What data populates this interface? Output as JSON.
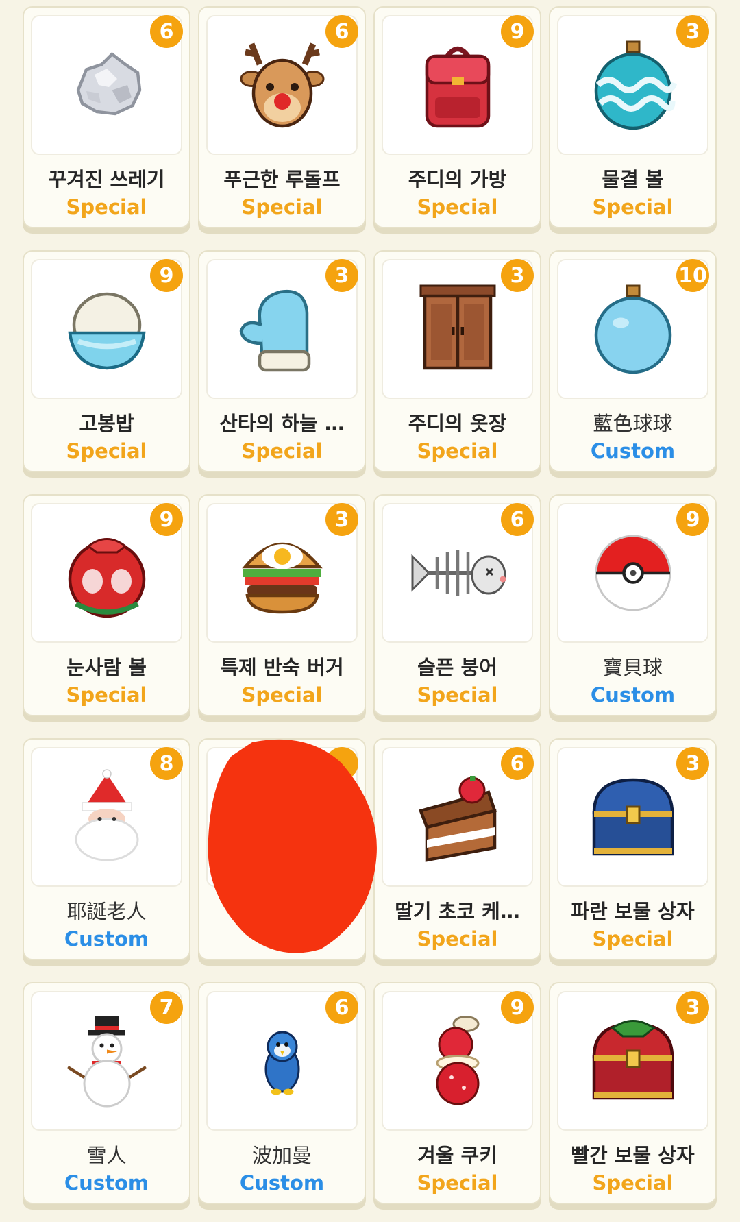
{
  "cards": [
    {
      "name": "꾸겨진 쓰레기",
      "tag": "Special",
      "count": "6",
      "icon": "crumpled-paper-icon"
    },
    {
      "name": "푸근한 루돌프",
      "tag": "Special",
      "count": "6",
      "icon": "reindeer-icon"
    },
    {
      "name": "주디의 가방",
      "tag": "Special",
      "count": "9",
      "icon": "red-backpack-icon"
    },
    {
      "name": "물결 볼",
      "tag": "Special",
      "count": "3",
      "icon": "wave-ornament-icon"
    },
    {
      "name": "고봉밥",
      "tag": "Special",
      "count": "9",
      "icon": "rice-bowl-icon"
    },
    {
      "name": "산타의 하늘 …",
      "tag": "Special",
      "count": "3",
      "icon": "blue-mitten-icon"
    },
    {
      "name": "주디의 옷장",
      "tag": "Special",
      "count": "3",
      "icon": "wardrobe-icon"
    },
    {
      "name": "藍色球球",
      "tag": "Custom",
      "count": "10",
      "icon": "blue-ornament-icon"
    },
    {
      "name": "눈사람 볼",
      "tag": "Special",
      "count": "9",
      "icon": "red-ornament-icon"
    },
    {
      "name": "특제 반숙 버거",
      "tag": "Special",
      "count": "3",
      "icon": "burger-icon"
    },
    {
      "name": "슬픈 붕어",
      "tag": "Special",
      "count": "6",
      "icon": "fish-skeleton-icon"
    },
    {
      "name": "寶貝球",
      "tag": "Custom",
      "count": "9",
      "icon": "pokeball-icon"
    },
    {
      "name": "耶誕老人",
      "tag": "Custom",
      "count": "8",
      "icon": "santa-icon"
    },
    {
      "name": "",
      "tag": "",
      "count": "",
      "icon": "redacted-item-icon"
    },
    {
      "name": "딸기 초코 케…",
      "tag": "Special",
      "count": "6",
      "icon": "cake-slice-icon"
    },
    {
      "name": "파란 보물 상자",
      "tag": "Special",
      "count": "3",
      "icon": "blue-chest-icon"
    },
    {
      "name": "雪人",
      "tag": "Custom",
      "count": "7",
      "icon": "snowman-icon"
    },
    {
      "name": "波加曼",
      "tag": "Custom",
      "count": "6",
      "icon": "penguin-icon"
    },
    {
      "name": "겨울 쿠키",
      "tag": "Special",
      "count": "9",
      "icon": "strawberry-cookie-icon"
    },
    {
      "name": "빨간 보물 상자",
      "tag": "Special",
      "count": "3",
      "icon": "red-chest-icon"
    }
  ],
  "colors": {
    "special": "#f2a51b",
    "custom": "#2b8ee6",
    "badge": "#f5a30f",
    "redaction": "#f5330f"
  }
}
